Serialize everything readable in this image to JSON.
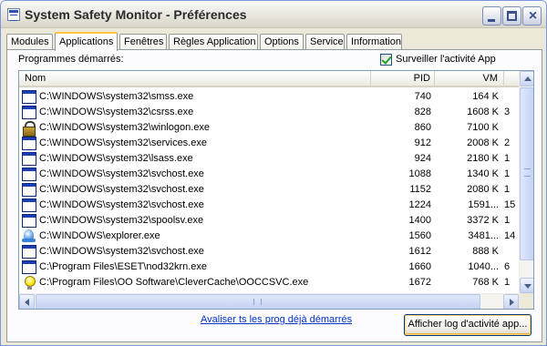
{
  "window": {
    "title": "System Safety Monitor - Préférences",
    "controls": {
      "minimize": "minimize",
      "maximize": "maximize",
      "close": "×"
    }
  },
  "tabs": [
    {
      "label": "Modules",
      "active": false
    },
    {
      "label": "Applications",
      "active": true
    },
    {
      "label": "Fenêtres",
      "active": false
    },
    {
      "label": "Règles Application",
      "active": false
    },
    {
      "label": "Options",
      "active": false
    },
    {
      "label": "Service",
      "active": false
    },
    {
      "label": "Information",
      "active": false
    }
  ],
  "panel": {
    "programs_label": "Programmes démarrés:",
    "monitor_checkbox": {
      "label": "Surveiller l'activité App",
      "checked": true
    }
  },
  "table": {
    "columns": [
      "Nom",
      "PID",
      "VM",
      ""
    ],
    "rows": [
      {
        "icon": "window-icon",
        "path": "C:\\WINDOWS\\system32\\smss.exe",
        "pid": "740",
        "vm": "164 K",
        "extra": ""
      },
      {
        "icon": "window-icon",
        "path": "C:\\WINDOWS\\system32\\csrss.exe",
        "pid": "828",
        "vm": "1608 K",
        "extra": "3"
      },
      {
        "icon": "lock-icon",
        "path": "C:\\WINDOWS\\system32\\winlogon.exe",
        "pid": "860",
        "vm": "7100 K",
        "extra": ""
      },
      {
        "icon": "window-icon",
        "path": "C:\\WINDOWS\\system32\\services.exe",
        "pid": "912",
        "vm": "2008 K",
        "extra": "2"
      },
      {
        "icon": "window-icon",
        "path": "C:\\WINDOWS\\system32\\lsass.exe",
        "pid": "924",
        "vm": "2180 K",
        "extra": "1"
      },
      {
        "icon": "window-icon",
        "path": "C:\\WINDOWS\\system32\\svchost.exe",
        "pid": "1088",
        "vm": "1340 K",
        "extra": "1"
      },
      {
        "icon": "window-icon",
        "path": "C:\\WINDOWS\\system32\\svchost.exe",
        "pid": "1152",
        "vm": "2080 K",
        "extra": "1"
      },
      {
        "icon": "window-icon",
        "path": "C:\\WINDOWS\\system32\\svchost.exe",
        "pid": "1224",
        "vm": "1591...",
        "extra": "15"
      },
      {
        "icon": "window-icon",
        "path": "C:\\WINDOWS\\system32\\spoolsv.exe",
        "pid": "1400",
        "vm": "3372 K",
        "extra": "1"
      },
      {
        "icon": "explorer-icon",
        "path": "C:\\WINDOWS\\explorer.exe",
        "pid": "1560",
        "vm": "3481...",
        "extra": "14"
      },
      {
        "icon": "window-icon",
        "path": "C:\\WINDOWS\\system32\\svchost.exe",
        "pid": "1612",
        "vm": "888 K",
        "extra": ""
      },
      {
        "icon": "window-icon",
        "path": "C:\\Program Files\\ESET\\nod32krn.exe",
        "pid": "1660",
        "vm": "1040...",
        "extra": "6"
      },
      {
        "icon": "bulb-icon",
        "path": "C:\\Program Files\\OO Software\\CleverCache\\OOCCSVC.exe",
        "pid": "1672",
        "vm": "768 K",
        "extra": "1"
      }
    ]
  },
  "footer": {
    "scan_link": "Avaliser ts les prog déjà démarrés",
    "log_button": "Afficher log d'activité app..."
  },
  "colors": {
    "tab_accent": "#ffc73c",
    "link": "#0033cc",
    "checkbox_check": "#21a121"
  }
}
